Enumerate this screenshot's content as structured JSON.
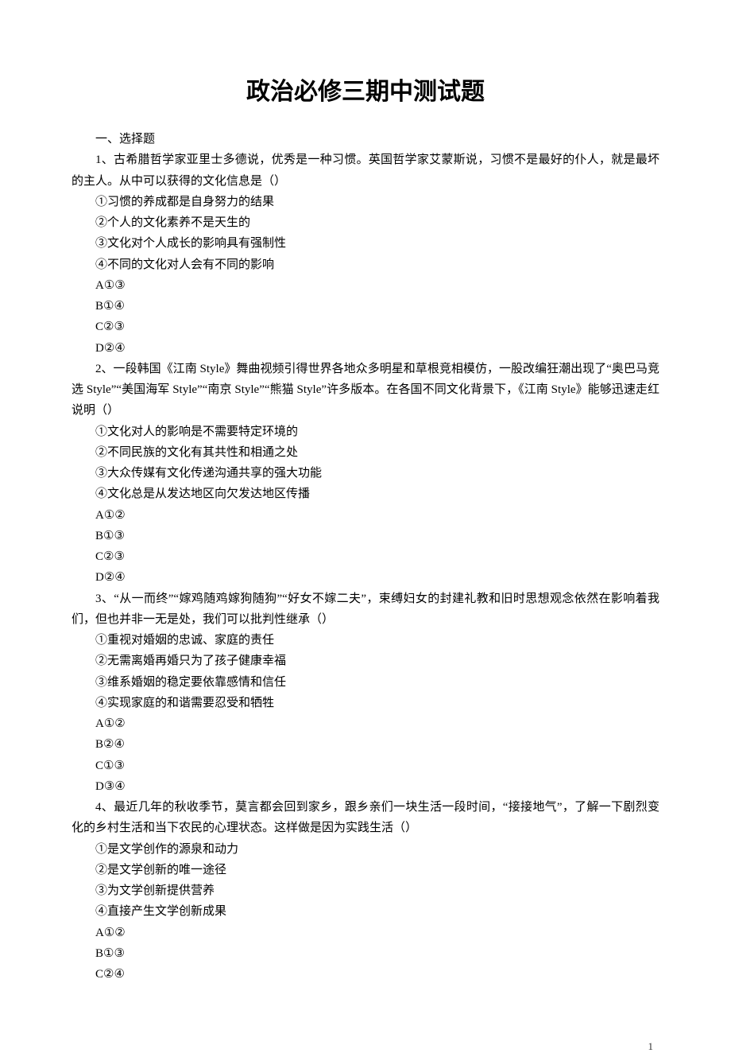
{
  "title": "政治必修三期中测试题",
  "section_label": "一、选择题",
  "questions": [
    {
      "stem": "1、古希腊哲学家亚里士多德说，优秀是一种习惯。英国哲学家艾蒙斯说，习惯不是最好的仆人，就是最坏的主人。从中可以获得的文化信息是（）",
      "lines": [
        "①习惯的养成都是自身努力的结果",
        "②个人的文化素养不是天生的",
        "③文化对个人成长的影响具有强制性",
        "④不同的文化对人会有不同的影响",
        "A①③",
        "B①④",
        "C②③",
        "D②④"
      ]
    },
    {
      "stem": "2、一段韩国《江南 Style》舞曲视频引得世界各地众多明星和草根竞相模仿，一股改编狂潮出现了“奥巴马竞选 Style”“美国海军 Style”“南京 Style”“熊猫 Style”许多版本。在各国不同文化背景下，《江南 Style》能够迅速走红说明（）",
      "lines": [
        "①文化对人的影响是不需要特定环境的",
        "②不同民族的文化有其共性和相通之处",
        "③大众传媒有文化传递沟通共享的强大功能",
        "④文化总是从发达地区向欠发达地区传播",
        "A①②",
        "B①③",
        "C②③",
        "D②④"
      ]
    },
    {
      "stem": "3、“从一而终”“嫁鸡随鸡嫁狗随狗”“好女不嫁二夫”，束缚妇女的封建礼教和旧时思想观念依然在影响着我们，但也并非一无是处，我们可以批判性继承（）",
      "lines": [
        "①重视对婚姻的忠诚、家庭的责任",
        "②无需离婚再婚只为了孩子健康幸福",
        "③维系婚姻的稳定要依靠感情和信任",
        "④实现家庭的和谐需要忍受和牺牲",
        "A①②",
        "B②④",
        "C①③",
        "D③④"
      ]
    },
    {
      "stem": "4、最近几年的秋收季节，莫言都会回到家乡，跟乡亲们一块生活一段时间，“接接地气”，了解一下剧烈变化的乡村生活和当下农民的心理状态。这样做是因为实践生活（）",
      "lines": [
        "①是文学创作的源泉和动力",
        "②是文学创新的唯一途径",
        "③为文学创新提供营养",
        "④直接产生文学创新成果",
        "A①②",
        "B①③",
        "C②④"
      ]
    }
  ],
  "page_number": "1"
}
